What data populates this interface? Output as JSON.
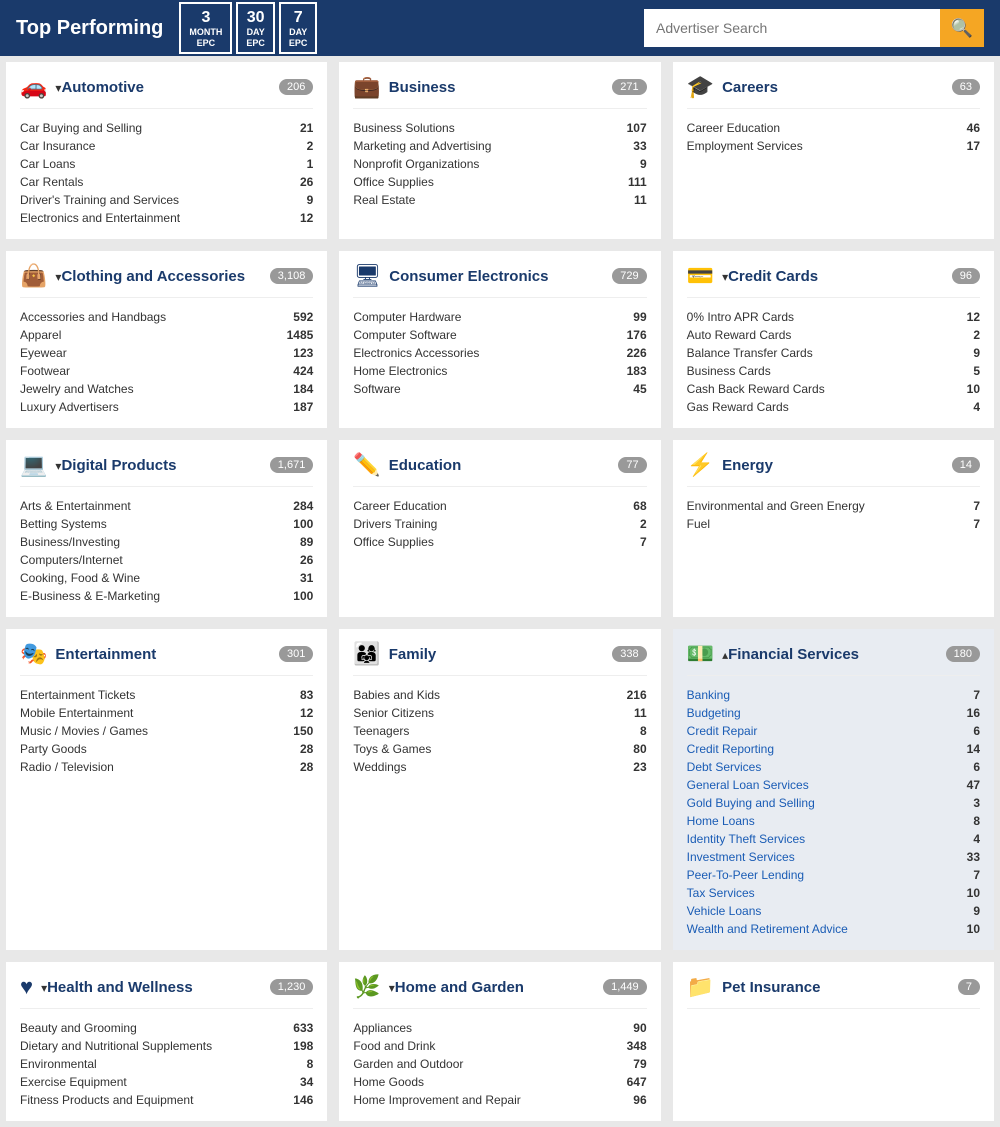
{
  "header": {
    "title": "Top Performing",
    "epc_buttons": [
      {
        "num": "3",
        "lbl": "MONTH EPC"
      },
      {
        "num": "30",
        "lbl": "DAY EPC"
      },
      {
        "num": "7",
        "lbl": "DAY EPC"
      }
    ],
    "search_placeholder": "Advertiser Search",
    "search_icon": "🔍"
  },
  "categories": [
    {
      "id": "automotive",
      "icon": "🚗",
      "title": "Automotive",
      "arrow": "down",
      "count": "206",
      "subcategories": [
        {
          "name": "Car Buying and Selling",
          "count": "21"
        },
        {
          "name": "Car Insurance",
          "count": "2"
        },
        {
          "name": "Car Loans",
          "count": "1"
        },
        {
          "name": "Car Rentals",
          "count": "26"
        },
        {
          "name": "Driver's Training and Services",
          "count": "9"
        },
        {
          "name": "Electronics and Entertainment",
          "count": "12"
        }
      ]
    },
    {
      "id": "business",
      "icon": "💼",
      "title": "Business",
      "arrow": "none",
      "count": "271",
      "subcategories": [
        {
          "name": "Business Solutions",
          "count": "107"
        },
        {
          "name": "Marketing and Advertising",
          "count": "33"
        },
        {
          "name": "Nonprofit Organizations",
          "count": "9"
        },
        {
          "name": "Office Supplies",
          "count": "111"
        },
        {
          "name": "Real Estate",
          "count": "11"
        }
      ]
    },
    {
      "id": "careers",
      "icon": "🎓",
      "title": "Careers",
      "arrow": "none",
      "count": "63",
      "subcategories": [
        {
          "name": "Career Education",
          "count": "46"
        },
        {
          "name": "Employment Services",
          "count": "17"
        }
      ]
    },
    {
      "id": "clothing",
      "icon": "👜",
      "title": "Clothing and Accessories",
      "arrow": "down",
      "count": "3,108",
      "subcategories": [
        {
          "name": "Accessories and Handbags",
          "count": "592"
        },
        {
          "name": "Apparel",
          "count": "1485"
        },
        {
          "name": "Eyewear",
          "count": "123"
        },
        {
          "name": "Footwear",
          "count": "424"
        },
        {
          "name": "Jewelry and Watches",
          "count": "184"
        },
        {
          "name": "Luxury Advertisers",
          "count": "187"
        }
      ]
    },
    {
      "id": "consumer-electronics",
      "icon": "🖥️",
      "title": "Consumer Electronics",
      "arrow": "none",
      "count": "729",
      "subcategories": [
        {
          "name": "Computer Hardware",
          "count": "99"
        },
        {
          "name": "Computer Software",
          "count": "176"
        },
        {
          "name": "Electronics Accessories",
          "count": "226"
        },
        {
          "name": "Home Electronics",
          "count": "183"
        },
        {
          "name": "Software",
          "count": "45"
        }
      ]
    },
    {
      "id": "credit-cards",
      "icon": "💳",
      "title": "Credit Cards",
      "arrow": "down",
      "count": "96",
      "subcategories": [
        {
          "name": "0% Intro APR Cards",
          "count": "12"
        },
        {
          "name": "Auto Reward Cards",
          "count": "2"
        },
        {
          "name": "Balance Transfer Cards",
          "count": "9"
        },
        {
          "name": "Business Cards",
          "count": "5"
        },
        {
          "name": "Cash Back Reward Cards",
          "count": "10"
        },
        {
          "name": "Gas Reward Cards",
          "count": "4"
        }
      ]
    },
    {
      "id": "digital-products",
      "icon": "💻",
      "title": "Digital Products",
      "arrow": "down",
      "count": "1,671",
      "subcategories": [
        {
          "name": "Arts & Entertainment",
          "count": "284"
        },
        {
          "name": "Betting Systems",
          "count": "100"
        },
        {
          "name": "Business/Investing",
          "count": "89"
        },
        {
          "name": "Computers/Internet",
          "count": "26"
        },
        {
          "name": "Cooking, Food & Wine",
          "count": "31"
        },
        {
          "name": "E-Business & E-Marketing",
          "count": "100"
        }
      ]
    },
    {
      "id": "education",
      "icon": "✏️",
      "title": "Education",
      "arrow": "none",
      "count": "77",
      "subcategories": [
        {
          "name": "Career Education",
          "count": "68"
        },
        {
          "name": "Drivers Training",
          "count": "2"
        },
        {
          "name": "Office Supplies",
          "count": "7"
        }
      ]
    },
    {
      "id": "energy",
      "icon": "⚡",
      "title": "Energy",
      "arrow": "none",
      "count": "14",
      "subcategories": [
        {
          "name": "Environmental and Green Energy",
          "count": "7"
        },
        {
          "name": "Fuel",
          "count": "7"
        }
      ]
    },
    {
      "id": "entertainment",
      "icon": "🎭",
      "title": "Entertainment",
      "arrow": "none",
      "count": "301",
      "subcategories": [
        {
          "name": "Entertainment Tickets",
          "count": "83"
        },
        {
          "name": "Mobile Entertainment",
          "count": "12"
        },
        {
          "name": "Music / Movies / Games",
          "count": "150"
        },
        {
          "name": "Party Goods",
          "count": "28"
        },
        {
          "name": "Radio / Television",
          "count": "28"
        }
      ]
    },
    {
      "id": "family",
      "icon": "👨‍👩‍👧‍👦",
      "title": "Family",
      "arrow": "none",
      "count": "338",
      "subcategories": [
        {
          "name": "Babies and Kids",
          "count": "216"
        },
        {
          "name": "Senior Citizens",
          "count": "11"
        },
        {
          "name": "Teenagers",
          "count": "8"
        },
        {
          "name": "Toys & Games",
          "count": "80"
        },
        {
          "name": "Weddings",
          "count": "23"
        }
      ]
    },
    {
      "id": "financial-services",
      "icon": "💰",
      "title": "Financial Services",
      "arrow": "up",
      "count": "180",
      "highlight": true,
      "subcategories": [
        {
          "name": "Banking",
          "count": "7"
        },
        {
          "name": "Budgeting",
          "count": "16"
        },
        {
          "name": "Credit Repair",
          "count": "6"
        },
        {
          "name": "Credit Reporting",
          "count": "14"
        },
        {
          "name": "Debt Services",
          "count": "6"
        },
        {
          "name": "General Loan Services",
          "count": "47"
        },
        {
          "name": "Gold Buying and Selling",
          "count": "3"
        },
        {
          "name": "Home Loans",
          "count": "8"
        },
        {
          "name": "Identity Theft Services",
          "count": "4"
        },
        {
          "name": "Investment Services",
          "count": "33"
        },
        {
          "name": "Peer-To-Peer Lending",
          "count": "7"
        },
        {
          "name": "Tax Services",
          "count": "10"
        },
        {
          "name": "Vehicle Loans",
          "count": "9"
        },
        {
          "name": "Wealth and Retirement Advice",
          "count": "10"
        }
      ]
    },
    {
      "id": "health-wellness",
      "icon": "❤️",
      "title": "Health and Wellness",
      "arrow": "down",
      "count": "1,230",
      "subcategories": [
        {
          "name": "Beauty and Grooming",
          "count": "633"
        },
        {
          "name": "Dietary and Nutritional Supplements",
          "count": "198"
        },
        {
          "name": "Environmental",
          "count": "8"
        },
        {
          "name": "Exercise Equipment",
          "count": "34"
        },
        {
          "name": "Fitness Products and Equipment",
          "count": "146"
        }
      ]
    },
    {
      "id": "home-garden",
      "icon": "🌿",
      "title": "Home and Garden",
      "arrow": "down",
      "count": "1,449",
      "subcategories": [
        {
          "name": "Appliances",
          "count": "90"
        },
        {
          "name": "Food and Drink",
          "count": "348"
        },
        {
          "name": "Garden and Outdoor",
          "count": "79"
        },
        {
          "name": "Home Goods",
          "count": "647"
        },
        {
          "name": "Home Improvement and Repair",
          "count": "96"
        }
      ]
    },
    {
      "id": "pet-insurance",
      "icon": "🐾",
      "title": "Pet Insurance",
      "arrow": "none",
      "count": "7",
      "subcategories": []
    }
  ]
}
